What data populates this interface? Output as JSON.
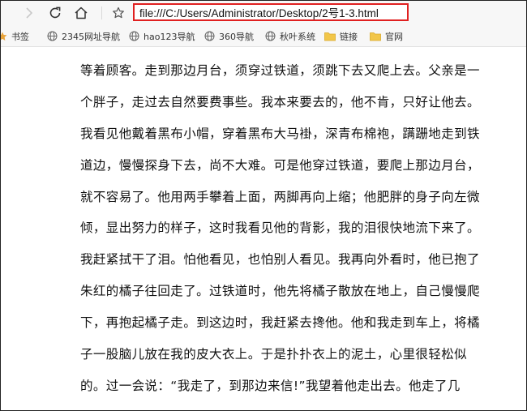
{
  "browser": {
    "address": "file:///C:/Users/Administrator/Desktop/2号1-3.html"
  },
  "bookmarks": [
    {
      "label": "书签",
      "icon": "star-icon"
    },
    {
      "label": "2345网址导航",
      "icon": "globe-icon"
    },
    {
      "label": "hao123导航",
      "icon": "globe-icon"
    },
    {
      "label": "360导航",
      "icon": "globe-icon"
    },
    {
      "label": "秋叶系统",
      "icon": "globe-icon"
    },
    {
      "label": "链接",
      "icon": "folder-icon"
    },
    {
      "label": "官网",
      "icon": "folder-icon"
    }
  ],
  "colors": {
    "address_highlight": "#e02020",
    "folder": "#f2c649",
    "bookmark_star": "#e8a33a"
  },
  "article": {
    "lines": [
      "等着顾客。走到那边月台，须穿过铁道，须跳下去又爬上去。父亲是一",
      "个胖子，走过去自然要费事些。我本来要去的，他不肯，只好让他去。",
      "我看见他戴着黑布小帽，穿着黑布大马褂，深青布棉袍，蹒跚地走到铁",
      "道边，慢慢探身下去，尚不大难。可是他穿过铁道，要爬上那边月台，",
      "就不容易了。他用两手攀着上面，两脚再向上缩；他肥胖的身子向左微",
      "倾，显出努力的样子，这时我看见他的背影，我的泪很快地流下来了。",
      "我赶紧拭干了泪。怕他看见，也怕别人看见。我再向外看时，他已抱了",
      "朱红的橘子往回走了。过铁道时，他先将橘子散放在地上，自己慢慢爬",
      "下，再抱起橘子走。到这边时，我赶紧去搀他。他和我走到车上，将橘",
      "子一股脑儿放在我的皮大衣上。于是扑扑衣上的泥土，心里很轻松似",
      "的。过一会说：“我走了，到那边来信!”我望着他走出去。他走了几"
    ]
  }
}
